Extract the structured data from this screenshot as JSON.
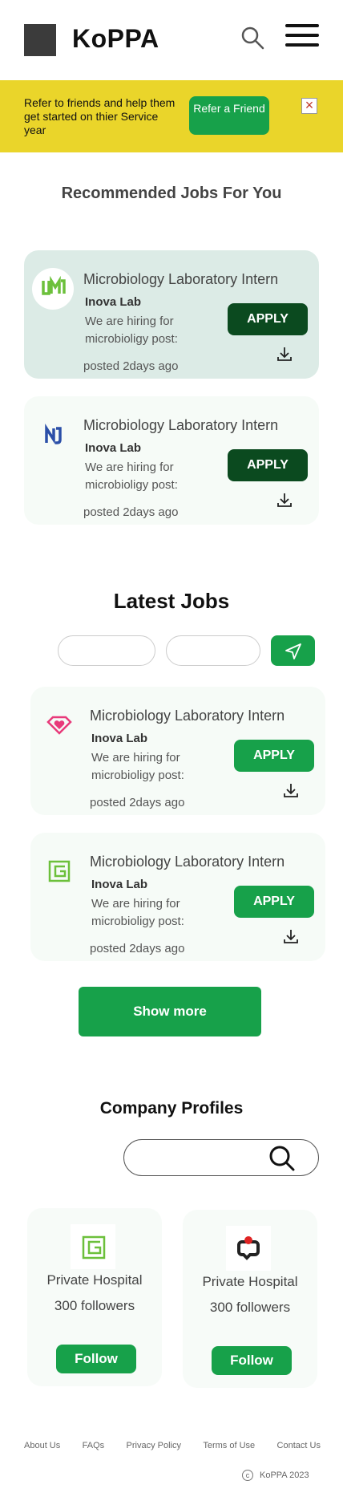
{
  "header": {
    "brand": "KoPPA",
    "search_icon": "search-icon",
    "menu_icon": "hamburger-menu-icon"
  },
  "banner": {
    "text": "Refer to friends and help them get started on thier Service year",
    "button_label": "Refer a Friend",
    "close_icon": "close-icon",
    "background": "#ead52a",
    "button_color": "#17a14a"
  },
  "recommended": {
    "title": "Recommended Jobs For You",
    "jobs": [
      {
        "title": "Microbiology Laboratory Intern",
        "company": "Inova Lab",
        "description": "We are hiring for microbioligy post:",
        "posted": "posted 2days ago",
        "apply": "APPLY",
        "logo": "um-logo"
      },
      {
        "title": "Microbiology Laboratory Intern",
        "company": "Inova Lab",
        "description": "We are hiring for microbioligy post:",
        "posted": "posted 2days ago",
        "apply": "APPLY",
        "logo": "nj-logo"
      }
    ]
  },
  "latest": {
    "title": "Latest Jobs",
    "filter_1_placeholder": "",
    "filter_2_placeholder": "",
    "send_icon": "send-icon",
    "jobs": [
      {
        "title": "Microbiology Laboratory Intern",
        "company": "Inova Lab",
        "description": "We are hiring for microbioligy post:",
        "posted": "posted 2days ago",
        "apply": "APPLY",
        "logo": "heart-diamond-logo"
      },
      {
        "title": "Microbiology Laboratory Intern",
        "company": "Inova Lab",
        "description": "We are hiring for microbioligy post:",
        "posted": "posted 2days ago",
        "apply": "APPLY",
        "logo": "g-logo"
      }
    ],
    "show_more": "Show more"
  },
  "companies": {
    "title": "Company Profiles",
    "search_placeholder": "",
    "items": [
      {
        "name": "Private Hospital",
        "followers": "300 followers",
        "follow": "Follow",
        "logo": "g-logo"
      },
      {
        "name": "Private Hospital",
        "followers": "300 followers",
        "follow": "Follow",
        "logo": "chat-logo"
      }
    ]
  },
  "footer": {
    "links": [
      "About Us",
      "FAQs",
      "Privacy Policy",
      "Terms of Use",
      "Contact Us"
    ],
    "copyright": "KoPPA 2023",
    "copyright_icon": "copyright-icon"
  },
  "colors": {
    "accent": "#17a14a",
    "dark_accent": "#0b4a1f",
    "highlight_card": "#dcebe6"
  }
}
